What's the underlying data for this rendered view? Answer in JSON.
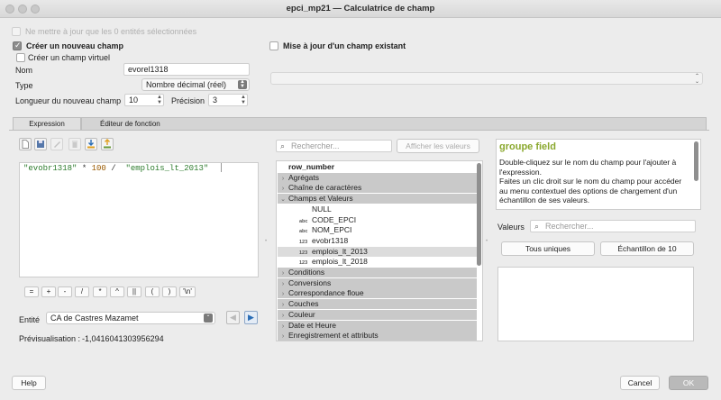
{
  "window": {
    "title": "epci_mp21 — Calculatrice de champ"
  },
  "top": {
    "update_selected_label": "Ne mettre à jour que les 0 entités sélectionnées"
  },
  "create": {
    "checkbox_label": "Créer un nouveau champ",
    "virtual_label": "Créer un champ virtuel",
    "name_label": "Nom",
    "name_value": "evorel1318",
    "type_label": "Type",
    "type_value": "Nombre décimal (réel)",
    "length_label": "Longueur du nouveau champ",
    "length_value": "10",
    "precision_label": "Précision",
    "precision_value": "3"
  },
  "update": {
    "checkbox_label": "Mise à jour d'un champ existant"
  },
  "tabs": [
    {
      "label": "Expression"
    },
    {
      "label": "Éditeur de fonction"
    }
  ],
  "expression": {
    "part1": "\"evobr1318\"",
    "part2": " * ",
    "part3": "100",
    "part4": " /  ",
    "part5": "\"emplois_lt_2013\""
  },
  "operators": [
    "=",
    "+",
    "-",
    "/",
    "*",
    "^",
    "||",
    "(",
    ")",
    "'\\n'"
  ],
  "entity": {
    "label": "Entité",
    "value": "CA de Castres Mazamet"
  },
  "preview": {
    "label": "Prévisualisation :",
    "value": "-1,0416041303956294"
  },
  "search": {
    "placeholder": "Rechercher...",
    "show_values_label": "Afficher les valeurs"
  },
  "tree": [
    {
      "label": "row_number",
      "kind": "bold"
    },
    {
      "label": "Agrégats",
      "kind": "group",
      "caret": "›"
    },
    {
      "label": "Chaîne de caractères",
      "kind": "group",
      "caret": "›"
    },
    {
      "label": "Champs et Valeurs",
      "kind": "group",
      "caret": "⌄"
    },
    {
      "label": "NULL",
      "kind": "child",
      "icon": ""
    },
    {
      "label": "CODE_EPCI",
      "kind": "child",
      "icon": "abc"
    },
    {
      "label": "NOM_EPCI",
      "kind": "child",
      "icon": "abc"
    },
    {
      "label": "evobr1318",
      "kind": "child",
      "icon": "123"
    },
    {
      "label": "emplois_lt_2013",
      "kind": "childsel",
      "icon": "123"
    },
    {
      "label": "emplois_lt_2018",
      "kind": "child",
      "icon": "123"
    },
    {
      "label": "Conditions",
      "kind": "group",
      "caret": "›"
    },
    {
      "label": "Conversions",
      "kind": "group",
      "caret": "›"
    },
    {
      "label": "Correspondance floue",
      "kind": "group",
      "caret": "›"
    },
    {
      "label": "Couches",
      "kind": "group",
      "caret": "›"
    },
    {
      "label": "Couleur",
      "kind": "group",
      "caret": "›"
    },
    {
      "label": "Date et Heure",
      "kind": "group",
      "caret": "›"
    },
    {
      "label": "Enregistrement et attributs",
      "kind": "group",
      "caret": "›"
    }
  ],
  "help": {
    "title": "groupe field",
    "text1": "Double-cliquez sur le nom du champ pour l'ajouter à l'expression.",
    "text2": "Faites un clic droit sur le nom du champ pour accéder au menu contextuel des options de chargement d'un échantillon de ses valeurs."
  },
  "values": {
    "label": "Valeurs",
    "search_placeholder": "Rechercher...",
    "all_unique_label": "Tous uniques",
    "sample_label": "Échantillon de 10"
  },
  "footer": {
    "help_label": "Help",
    "cancel_label": "Cancel",
    "ok_label": "OK"
  },
  "colors": {
    "help_title": "#8aa82e",
    "string_literal": "#2c7b2c",
    "number_literal": "#9a5a00"
  }
}
